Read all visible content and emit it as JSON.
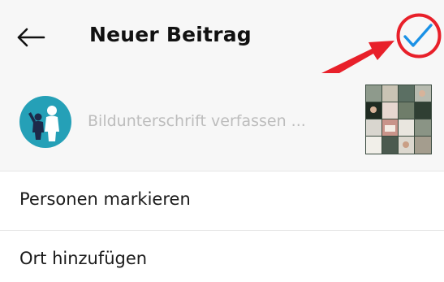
{
  "header": {
    "title": "Neuer Beitrag",
    "back_icon": "arrow-left-icon",
    "confirm_icon": "checkmark-icon",
    "confirm_color": "#1a91e6"
  },
  "annotation": {
    "circle_color": "#e8202a",
    "arrow_color": "#e8202a"
  },
  "caption": {
    "placeholder": "Bildunterschrift verfassen ...",
    "value": "",
    "avatar_color": "#25a0b7"
  },
  "options": {
    "tag_people": "Personen markieren",
    "add_location": "Ort hinzufügen"
  }
}
